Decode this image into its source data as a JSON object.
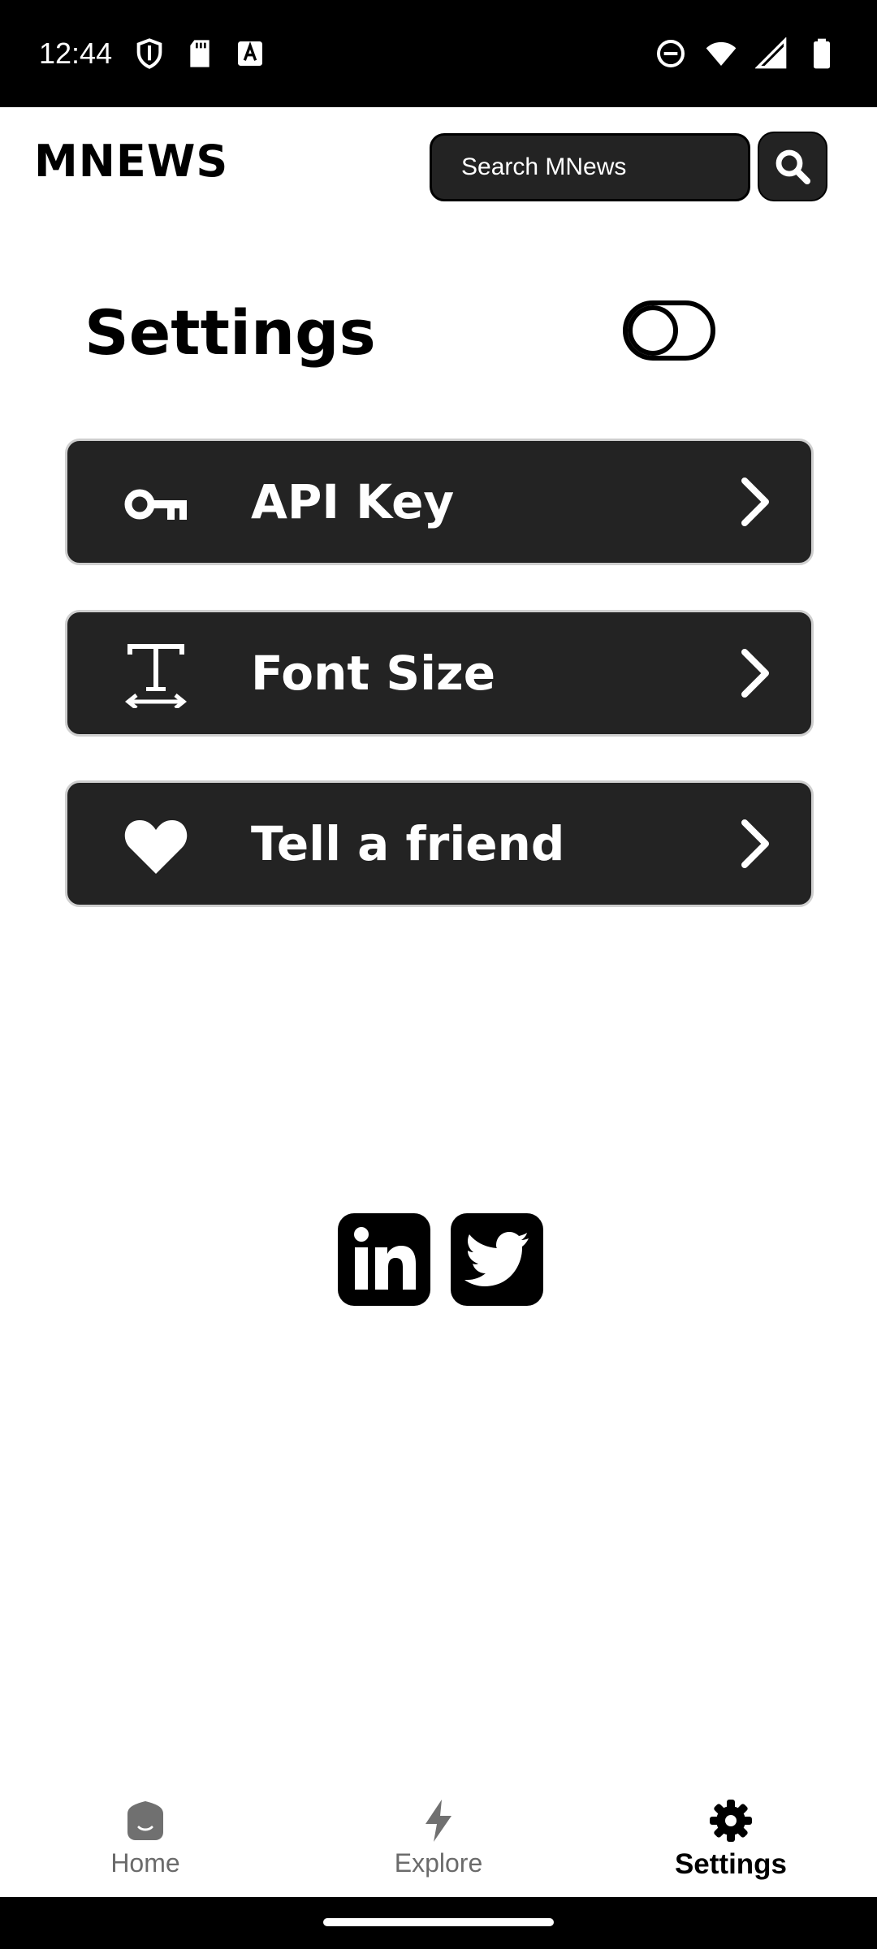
{
  "status_bar": {
    "time": "12:44",
    "left_icons": [
      "shield-icon",
      "sd-card-icon",
      "a-badge-icon"
    ],
    "right_icons": [
      "do-not-disturb-icon",
      "wifi-icon",
      "signal-icon",
      "battery-icon"
    ]
  },
  "header": {
    "logo": "MNEWS",
    "search": {
      "placeholder": "Search MNews",
      "button_icon": "search-icon"
    }
  },
  "settings": {
    "title": "Settings",
    "theme_toggle": {
      "on": false
    }
  },
  "menu": {
    "items": [
      {
        "label": "API Key",
        "icon": "key-icon"
      },
      {
        "label": "Font Size",
        "icon": "text-size-icon"
      },
      {
        "label": "Tell a friend",
        "icon": "heart-icon"
      }
    ]
  },
  "social": [
    "linkedin-icon",
    "twitter-icon"
  ],
  "bottom_nav": {
    "items": [
      {
        "label": "Home",
        "icon": "home-icon",
        "active": false
      },
      {
        "label": "Explore",
        "icon": "lightning-icon",
        "active": false
      },
      {
        "label": "Settings",
        "icon": "gear-icon",
        "active": true
      }
    ]
  },
  "colors": {
    "card_bg": "#232323",
    "text_primary": "#000000",
    "text_inactive": "#6b6b6b",
    "status_bar_bg": "#000000"
  }
}
